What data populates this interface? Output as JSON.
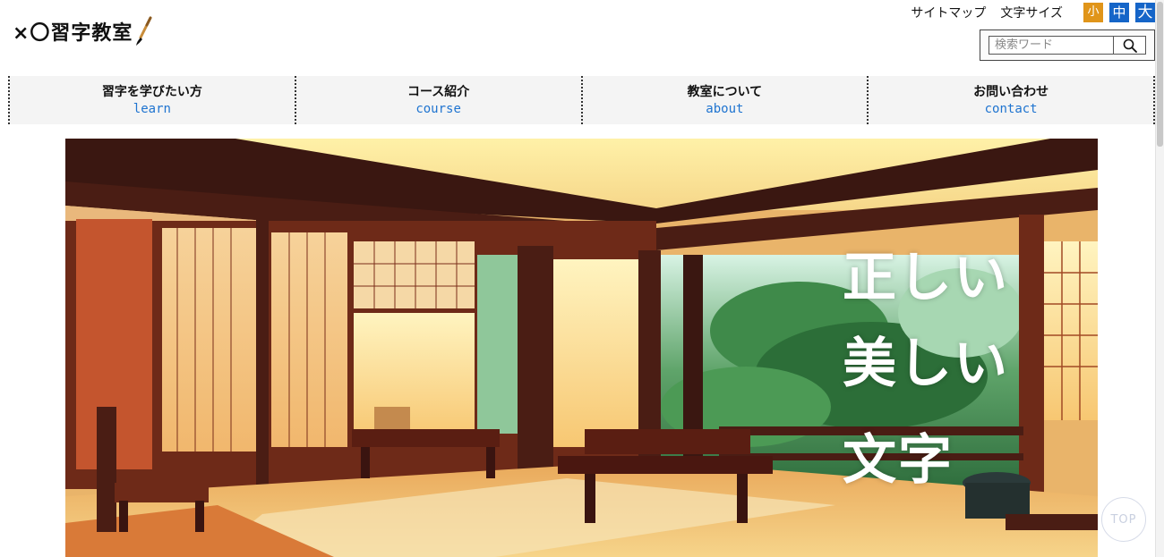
{
  "header": {
    "logo_text": "×〇習字教室",
    "site_map_label": "サイトマップ",
    "font_size_label": "文字サイズ",
    "font_size_buttons": [
      {
        "label": "小",
        "color": "#e0951a"
      },
      {
        "label": "中",
        "color": "#1565c8"
      },
      {
        "label": "大",
        "color": "#1565c8"
      }
    ],
    "search": {
      "placeholder": "検索ワード",
      "value": "",
      "icon": "search-icon"
    }
  },
  "nav": {
    "items": [
      {
        "label": "習字を学びたい方",
        "sub": "learn"
      },
      {
        "label": "コース紹介",
        "sub": "course"
      },
      {
        "label": "教室について",
        "sub": "about"
      },
      {
        "label": "お問い合わせ",
        "sub": "contact"
      }
    ]
  },
  "hero": {
    "copy_lines": [
      "正しい",
      "美しい",
      "文字"
    ]
  },
  "to_top_label": "TOP",
  "colors": {
    "accent_blue": "#1f74d0",
    "size_small_orange": "#e0951a",
    "size_medium_blue": "#1565c8"
  }
}
